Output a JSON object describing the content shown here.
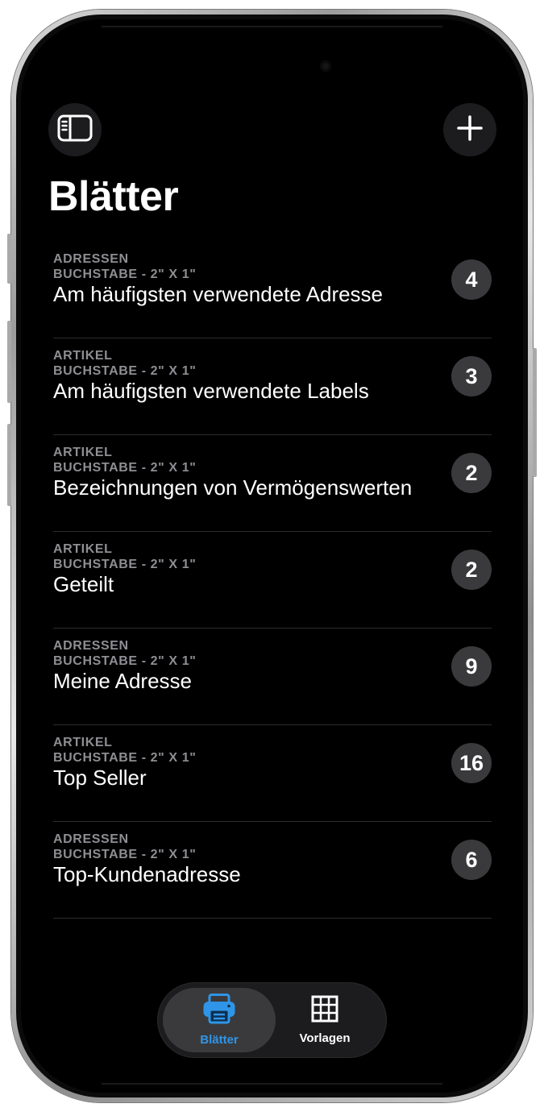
{
  "header": {
    "title": "Blätter"
  },
  "sheets": [
    {
      "category": "ADRESSEN",
      "size": "BUCHSTABE - 2\" X 1\"",
      "name": "Am häufigsten verwendete Adresse",
      "count": "4"
    },
    {
      "category": "ARTIKEL",
      "size": "BUCHSTABE - 2\" X 1\"",
      "name": "Am häufigsten verwendete Labels",
      "count": "3"
    },
    {
      "category": "ARTIKEL",
      "size": "BUCHSTABE - 2\" X 1\"",
      "name": "Bezeichnungen von Vermögenswerten",
      "count": "2"
    },
    {
      "category": "ARTIKEL",
      "size": "BUCHSTABE - 2\" X 1\"",
      "name": "Geteilt",
      "count": "2"
    },
    {
      "category": "ADRESSEN",
      "size": "BUCHSTABE - 2\" X 1\"",
      "name": "Meine Adresse",
      "count": "9"
    },
    {
      "category": "ARTIKEL",
      "size": "BUCHSTABE - 2\" X 1\"",
      "name": "Top Seller",
      "count": "16"
    },
    {
      "category": "ADRESSEN",
      "size": "BUCHSTABE - 2\" X 1\"",
      "name": "Top-Kundenadresse",
      "count": "6"
    }
  ],
  "tabbar": {
    "tabs": [
      {
        "label": "Blätter",
        "icon": "printer-icon",
        "active": true
      },
      {
        "label": "Vorlagen",
        "icon": "grid-icon",
        "active": false
      }
    ]
  },
  "colors": {
    "accent": "#2f95e8",
    "background": "#000000",
    "badge": "#3a3a3c",
    "secondary_text": "#8e8e93"
  }
}
